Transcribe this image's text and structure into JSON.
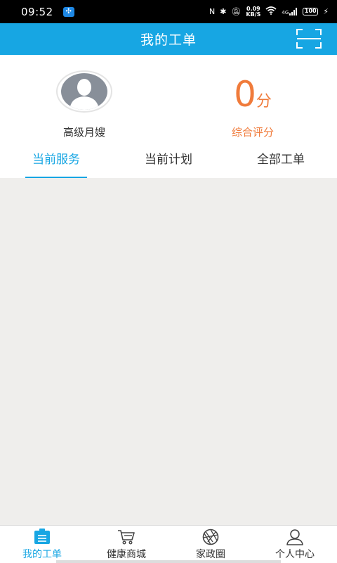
{
  "status_bar": {
    "time": "09:52",
    "net_speed_value": "0.09",
    "net_speed_unit": "KB/S",
    "signal_label": "4G",
    "battery": "100"
  },
  "header": {
    "title": "我的工单",
    "scan_icon": "scan-icon"
  },
  "profile": {
    "name": "高级月嫂",
    "score": "0",
    "score_unit": "分",
    "score_label": "综合评分"
  },
  "tabs": [
    {
      "label": "当前服务",
      "active": true
    },
    {
      "label": "当前计划",
      "active": false
    },
    {
      "label": "全部工单",
      "active": false
    }
  ],
  "bottom_nav": [
    {
      "label": "我的工单",
      "icon": "work-order-icon",
      "active": true
    },
    {
      "label": "健康商城",
      "icon": "cart-icon",
      "active": false
    },
    {
      "label": "家政圈",
      "icon": "aperture-icon",
      "active": false
    },
    {
      "label": "个人中心",
      "icon": "person-icon",
      "active": false
    }
  ],
  "colors": {
    "primary": "#17a6e3",
    "score": "#f07b3b"
  }
}
